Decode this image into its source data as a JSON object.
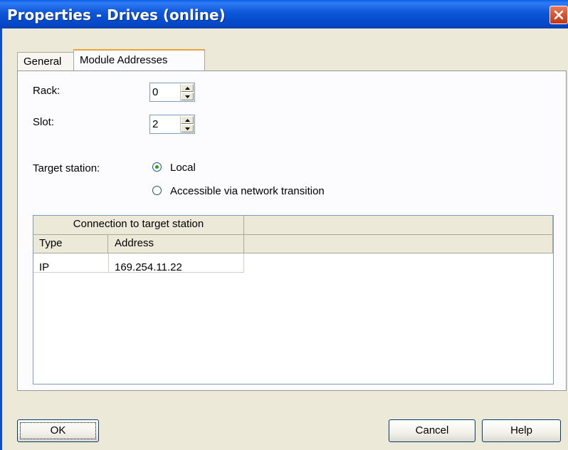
{
  "window": {
    "title": "Properties - Drives (online)"
  },
  "tabs": [
    {
      "label": "General",
      "active": false
    },
    {
      "label": "Module Addresses",
      "active": true
    }
  ],
  "form": {
    "rack_label": "Rack:",
    "rack_value": "0",
    "slot_label": "Slot:",
    "slot_value": "2",
    "target_label": "Target station:",
    "target_options": [
      {
        "label": "Local",
        "selected": true
      },
      {
        "label": "Accessible via network transition",
        "selected": false
      }
    ]
  },
  "table": {
    "group_header": "Connection to target station",
    "columns": [
      "Type",
      "Address"
    ],
    "rows": [
      [
        "IP",
        "169.254.11.22"
      ]
    ]
  },
  "buttons": {
    "ok": "OK",
    "cancel": "Cancel",
    "help": "Help"
  },
  "icons": {
    "close": "close-icon",
    "spin_up": "arrow-up-icon",
    "spin_down": "arrow-down-icon"
  },
  "colors": {
    "titlebar": "#0a56d8",
    "close": "#d8532f",
    "dialog_bg": "#ece9d8",
    "radio_dot": "#21a121"
  }
}
